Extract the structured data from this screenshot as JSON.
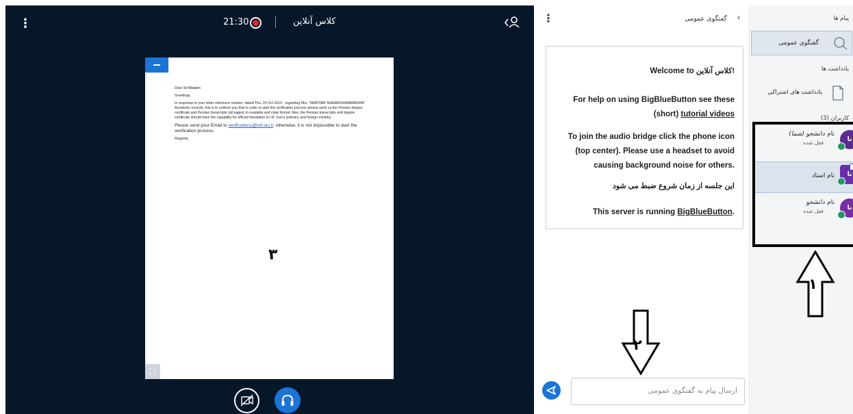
{
  "header": {
    "meeting_title": "کلاس آنلاین",
    "recording_time": "21:30",
    "accent_color": "#1b74d6",
    "record_color": "#e0262f"
  },
  "presentation": {
    "letter": {
      "salutation": "Dear Sir/Madam",
      "greeting": "Greetings,",
      "body": "In response to your letter reference number:  dated Thu, 24 Oct 2019  , regarding Mrs. \"MARYAM SHAHMOHAMMADIAN\"  Academic records, this is to uniform you that in order to start the verification process please send us the Persian degree certificate and Persian transcripts (all pages) in readable and clear format. Also, the Persian transcripts and degree certificate should have the capability for official translation in I.R. Iran's judiciary and foreign ministry.",
      "send_prefix": "Please send your Email to ",
      "send_link": "verifications@intl.iau.ir",
      "send_suffix": ", otherwise, it is not impossible to start the verification process.",
      "closing": "Regards,"
    },
    "annotation_number": "۳"
  },
  "chat": {
    "title": "گفتگوی عمومی",
    "welcome": {
      "line1_prefix": "Welcome to ",
      "line1_name": "کلاس آنلاین!",
      "help_text": "For help on using BigBlueButton see these ",
      "help_link": "tutorial videos",
      "help_suffix": "(short) ",
      "audio_text": "To join the audio bridge click the phone icon (top center). Please use a headset to avoid causing background noise for others.",
      "recording_notice": "این جلسه از زمان شروع ضبط می شود",
      "server_prefix": "This server is running ",
      "server_link": "BigBlueButton",
      "server_suffix": "."
    },
    "input_placeholder": "ارسال پیام به گفتگوی عمومی",
    "annotation_number": "۲"
  },
  "sidebar": {
    "messages_heading": "پیام ها",
    "public_chat_label": "گفتگوی عمومی",
    "notes_heading": "یادداشت ها",
    "shared_notes_label": "یادداشت های اشتراکی",
    "users_heading": "کاربران (3)",
    "users": [
      {
        "name": "نام دانشجو",
        "self_tag": "(شما)",
        "status": "قفل شده",
        "initials": "نا",
        "color": "#5e2a8e"
      },
      {
        "name": "نام استاد",
        "self_tag": "",
        "status": "",
        "initials": "نا",
        "color": "#6b2da8"
      },
      {
        "name": "نام دانشجو",
        "self_tag": "",
        "status": "قفل شده",
        "initials": "نا",
        "color": "#7a2ca5"
      }
    ],
    "annotation_number": "۱"
  }
}
